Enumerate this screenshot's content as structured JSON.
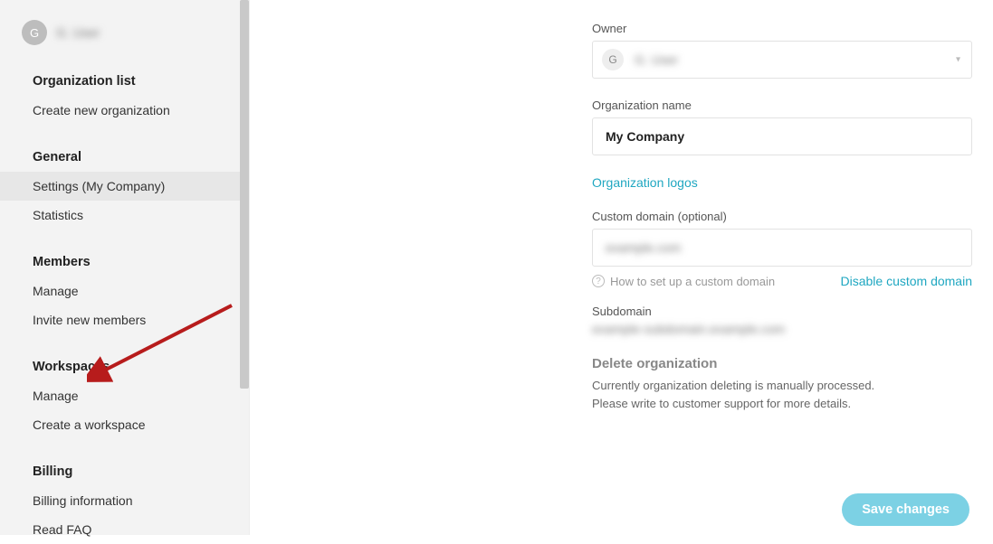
{
  "user": {
    "initial": "G",
    "name": "G. User"
  },
  "sidebar": {
    "sections": [
      {
        "heading": "Organization list",
        "items": [
          {
            "label": "Create new organization"
          }
        ]
      },
      {
        "heading": "General",
        "items": [
          {
            "label": "Settings (My Company)",
            "active": true
          },
          {
            "label": "Statistics"
          }
        ]
      },
      {
        "heading": "Members",
        "items": [
          {
            "label": "Manage"
          },
          {
            "label": "Invite new members"
          }
        ]
      },
      {
        "heading": "Workspaces",
        "items": [
          {
            "label": "Manage"
          },
          {
            "label": "Create a workspace"
          }
        ]
      },
      {
        "heading": "Billing",
        "items": [
          {
            "label": "Billing information"
          },
          {
            "label": "Read FAQ"
          }
        ]
      }
    ]
  },
  "form": {
    "owner_label": "Owner",
    "owner_initial": "G",
    "owner_name": "G. User",
    "org_name_label": "Organization name",
    "org_name_value": "My Company",
    "logos_link": "Organization logos",
    "custom_domain_label": "Custom domain (optional)",
    "custom_domain_value": "example.com",
    "custom_domain_help": "How to set up a custom domain",
    "disable_domain_link": "Disable custom domain",
    "subdomain_label": "Subdomain",
    "subdomain_value": "example-subdomain.example.com",
    "delete_heading": "Delete organization",
    "delete_text_1": "Currently organization deleting is manually processed.",
    "delete_text_2": "Please write to customer support for more details.",
    "save_button": "Save changes"
  }
}
